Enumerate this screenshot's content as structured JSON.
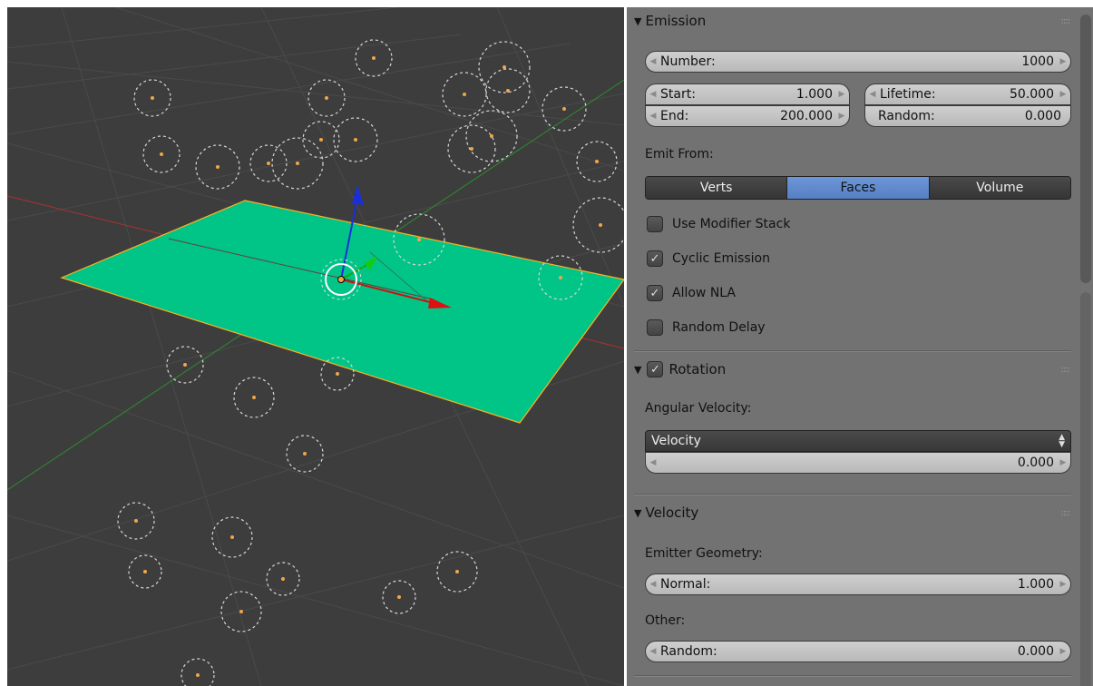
{
  "emission": {
    "title": "Emission",
    "number_label": "Number:",
    "number_value": "1000",
    "start_label": "Start:",
    "start_value": "1.000",
    "end_label": "End:",
    "end_value": "200.000",
    "lifetime_label": "Lifetime:",
    "lifetime_value": "50.000",
    "random_label": "Random:",
    "random_value": "0.000",
    "emit_from_label": "Emit From:",
    "emit_from_options": [
      "Verts",
      "Faces",
      "Volume"
    ],
    "emit_from_selected": "Faces",
    "checkboxes": [
      {
        "label": "Use Modifier Stack",
        "checked": false
      },
      {
        "label": "Cyclic Emission",
        "checked": true
      },
      {
        "label": "Allow NLA",
        "checked": true
      },
      {
        "label": "Random Delay",
        "checked": false
      }
    ]
  },
  "rotation": {
    "title": "Rotation",
    "enabled": true,
    "angular_velocity_label": "Angular Velocity:",
    "mode_value": "Velocity",
    "amount_value": "0.000"
  },
  "velocity": {
    "title": "Velocity",
    "emitter_geometry_label": "Emitter Geometry:",
    "normal_label": "Normal:",
    "normal_value": "1.000",
    "other_label": "Other:",
    "random_label": "Random:",
    "random_value": "0.000"
  },
  "glyphs": {
    "check": "✓",
    "collapse": "▼",
    "left": "◀",
    "right": "▶",
    "grip": "::::",
    "up": "▲",
    "down": "▼"
  },
  "colors": {
    "plane": "#00c587",
    "selected_tab": "#5680c4",
    "viewport_bg": "#3d3d3d",
    "panel_bg": "#727272",
    "particle": "#f0a64a"
  }
}
